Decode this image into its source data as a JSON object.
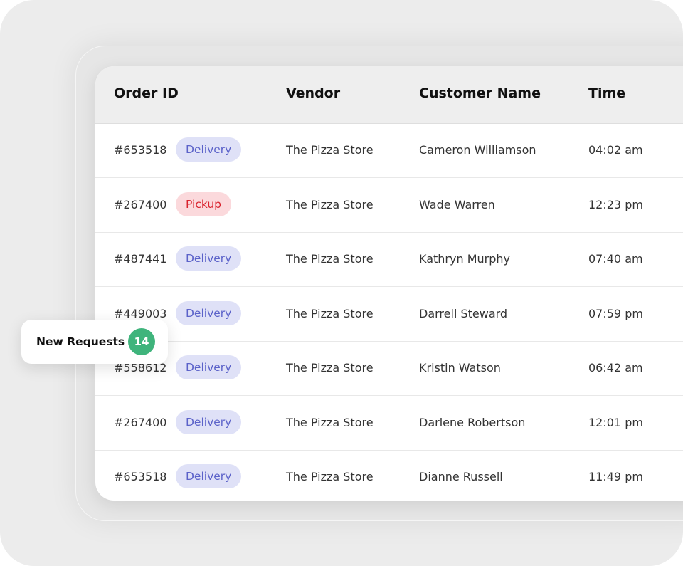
{
  "table": {
    "headers": {
      "order_id": "Order ID",
      "vendor": "Vendor",
      "customer": "Customer Name",
      "time": "Time"
    },
    "rows": [
      {
        "order_id": "#653518",
        "type": "Delivery",
        "vendor": "The Pizza Store",
        "customer": "Cameron Williamson",
        "time": "04:02 am"
      },
      {
        "order_id": "#267400",
        "type": "Pickup",
        "vendor": "The Pizza Store",
        "customer": "Wade Warren",
        "time": "12:23 pm"
      },
      {
        "order_id": "#487441",
        "type": "Delivery",
        "vendor": "The Pizza Store",
        "customer": "Kathryn Murphy",
        "time": "07:40 am"
      },
      {
        "order_id": "#449003",
        "type": "Delivery",
        "vendor": "The Pizza Store",
        "customer": "Darrell Steward",
        "time": "07:59 pm"
      },
      {
        "order_id": "#558612",
        "type": "Delivery",
        "vendor": "The Pizza Store",
        "customer": "Kristin Watson",
        "time": "06:42 am"
      },
      {
        "order_id": "#267400",
        "type": "Delivery",
        "vendor": "The Pizza Store",
        "customer": "Darlene Robertson",
        "time": "12:01 pm"
      },
      {
        "order_id": "#653518",
        "type": "Delivery",
        "vendor": "The Pizza Store",
        "customer": "Dianne Russell",
        "time": "11:49 pm"
      }
    ]
  },
  "badge_colors": {
    "Delivery": {
      "bg": "#dfe1f7",
      "fg": "#5b62c9"
    },
    "Pickup": {
      "bg": "#fbd9dc",
      "fg": "#d9232e"
    }
  },
  "new_requests": {
    "label": "New Requests",
    "count": "14",
    "count_color": "#3fb47c"
  }
}
